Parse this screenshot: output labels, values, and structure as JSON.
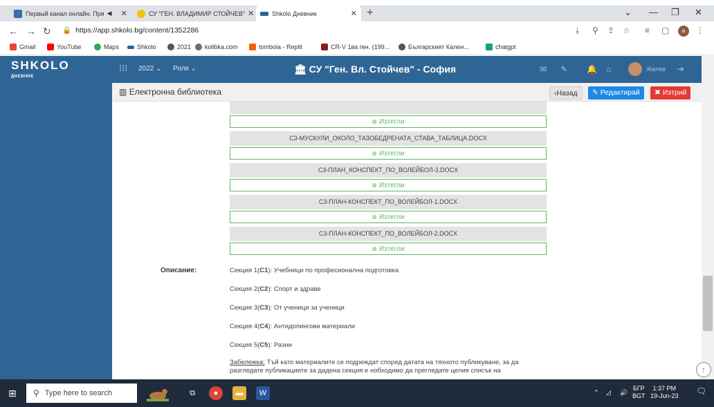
{
  "browser": {
    "tabs": [
      {
        "title": "Первый канал онлайн. Пря",
        "active": false
      },
      {
        "title": "СУ \"ГЕН. ВЛАДИМИР СТОЙЧЕВ\"",
        "active": false
      },
      {
        "title": "Shkolo Дневник",
        "active": true
      }
    ],
    "url": "https://app.shkolo.bg/content/1352286",
    "bookmarks": [
      {
        "label": "Gmail",
        "color": "#ea4335"
      },
      {
        "label": "YouTube",
        "color": "#ff0000"
      },
      {
        "label": "Maps",
        "color": "#34a853"
      },
      {
        "label": "Shkolo",
        "color": "#2f6594"
      },
      {
        "label": "2021",
        "color": "#555555"
      },
      {
        "label": "kolibka.com",
        "color": "#6d6d6d"
      },
      {
        "label": "tombola - Replit",
        "color": "#f26207"
      },
      {
        "label": "CR-V 1ва ген. (199...",
        "color": "#8b1a1a"
      },
      {
        "label": "Българският Кален...",
        "color": "#555555"
      },
      {
        "label": "chatgpt",
        "color": "#10a37f"
      }
    ],
    "profile_initial": "a"
  },
  "app": {
    "logo": "SHKOLO",
    "logo_sub": "ДНЕВНИК",
    "year": "2022",
    "role": "Роля",
    "school": "СУ \"Ген. Вл. Стойчев\" - София",
    "user": "Желев"
  },
  "page": {
    "title": "Електронна библиотека",
    "back_label": "‹Назад",
    "edit_label": "Редактирай",
    "delete_label": "Изтрий",
    "download_label": "Изтегли",
    "files": [
      "",
      "С3-МУСКУЛИ_ОКОЛО_ТАЗОБЕДРЕНАТА_СТАВА_ТАБЛИЦА.DOCX",
      "С3-ПЛАН_КОНСПЕКТ_ПО_ВОЛЕЙБОЛ-3.DOCX",
      "С3-ПЛАН-КОНСПЕКТ_ПО_ВОЛЕЙБОЛ-1.DOCX",
      "С3-ПЛАН-КОНСПЕКТ_ПО_ВОЛЕЙБОЛ-2.DOCX"
    ],
    "description_label": "Описание:",
    "sections": [
      {
        "prefix": "Секция 1(",
        "code": "С1",
        "suffix": "): ",
        "text": "Учебници по професионална подготовка"
      },
      {
        "prefix": "Секция 2(",
        "code": "С2",
        "suffix": "): ",
        "text": "Спорт и здраве"
      },
      {
        "prefix": "Секция 3(",
        "code": "С3",
        "suffix": "): ",
        "text": "От ученици за ученици"
      },
      {
        "prefix": "Секция 4(",
        "code": "С4",
        "suffix": "): ",
        "text": "Антидопингови материали"
      },
      {
        "prefix": "Секция 5(",
        "code": "С5",
        "suffix": "): ",
        "text": "Разни"
      }
    ],
    "note_label": "Забележка:",
    "note_text": "Тъй като материалите се подреждат според датата на тяхното публикуване, за да разгледате публикациите за дадена секция е нобходимо да прегледате целия списък на"
  },
  "taskbar": {
    "search_placeholder": "Type here to search",
    "lang_top": "БГР",
    "lang_bottom": "BGT",
    "time": "1:37 PM",
    "date": "19-Jun-23"
  }
}
